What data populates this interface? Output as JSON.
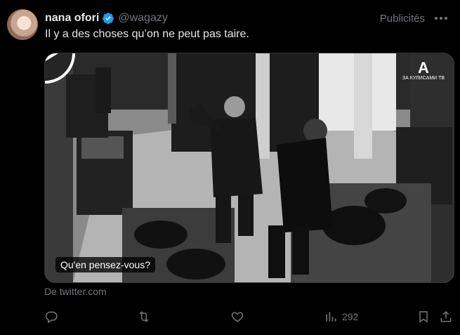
{
  "tweet": {
    "author_name": "nana ofori",
    "handle": "@wagazy",
    "promoted_label": "Publicités",
    "text": "Il y a des choses qu’on ne peut pas taire.",
    "source": "De twitter.com"
  },
  "media": {
    "caption": "Qu'en pensez-vous?",
    "watermark": "ЗА КУЛИСАМИ ТВ"
  },
  "actions": {
    "views_count": "292"
  },
  "colors": {
    "background": "#000000",
    "text": "#e7e9ea",
    "secondary": "#71767b",
    "verified": "#1d9bf0"
  },
  "icons": [
    "verified-badge-icon",
    "more-icon",
    "play-icon",
    "reply-icon",
    "retweet-icon",
    "like-icon",
    "views-icon",
    "bookmark-icon",
    "share-icon"
  ]
}
